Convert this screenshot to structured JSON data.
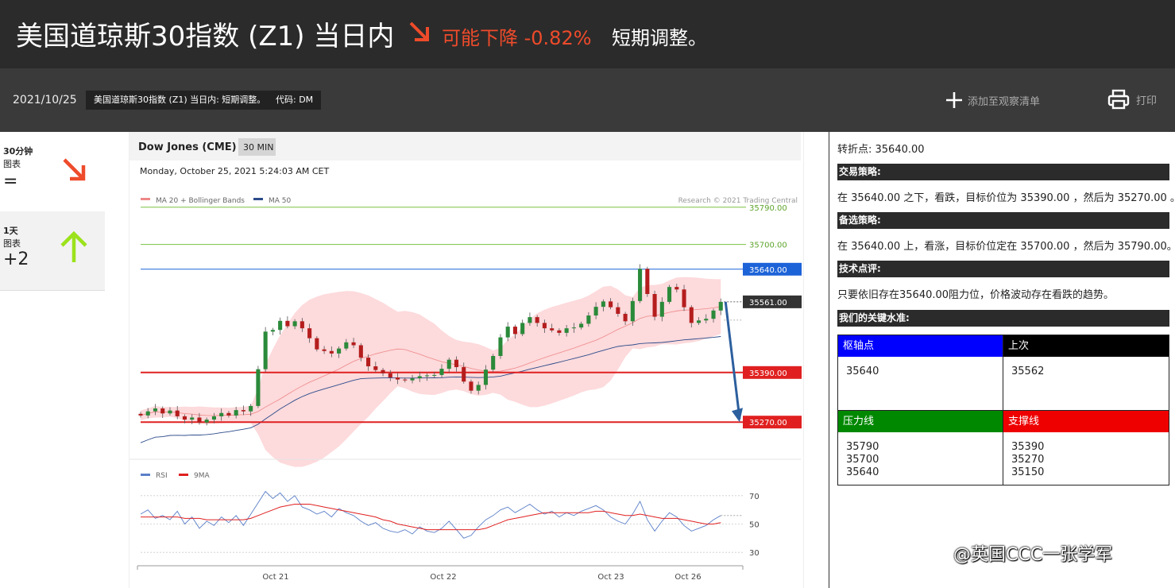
{
  "header": {
    "title": "美国道琼斯30指数 (Z1) 当日内",
    "trend_icon": "arrow-down-right-icon",
    "change_text": "可能下降 -0.82%",
    "summary": "短期调整。",
    "accent_color": "#ee4b2b"
  },
  "subbar": {
    "date": "2021/10/25",
    "name_chip": "美国道琼斯30指数 (Z1) 当日内: 短期调整。",
    "code_chip": "代码: DM",
    "watchlist_label": "添加至观察清单",
    "print_label": "打印"
  },
  "timeframes": [
    {
      "label": "30分钟",
      "sub": "图表",
      "score": "=",
      "icon": "arrow-down-right-icon",
      "color": "#ee4b2b"
    },
    {
      "label": "1天",
      "sub": "图表",
      "score": "+2",
      "icon": "arrow-up-icon",
      "color": "#9be21b"
    }
  ],
  "chart_header": {
    "instrument": "Dow Jones (CME)",
    "interval": "30 MIN",
    "timestamp": "Monday, October 25, 2021 5:24:03 AM CET",
    "legend_ma20": "MA 20 + Bollinger Bands",
    "legend_ma50": "MA 50",
    "credit": "Research © 2021 Trading Central"
  },
  "chart_data": [
    {
      "type": "candlestick",
      "x_tick_labels": [
        "Oct 21",
        "Oct 22",
        "Oct 23",
        "Oct 26"
      ],
      "levels": [
        {
          "value": 35790.0,
          "label": "35790.00",
          "kind": "resistance",
          "color": "#7ac142"
        },
        {
          "value": 35700.0,
          "label": "35700.00",
          "kind": "resistance",
          "color": "#7ac142"
        },
        {
          "value": 35640.0,
          "label": "35640.00",
          "kind": "pivot",
          "color": "#1d63d8"
        },
        {
          "value": 35561.0,
          "label": "35561.00",
          "kind": "last",
          "color": "#333333"
        },
        {
          "value": 35390.0,
          "label": "35390.00",
          "kind": "support",
          "color": "#e02020"
        },
        {
          "value": 35270.0,
          "label": "35270.00",
          "kind": "support",
          "color": "#e02020"
        }
      ],
      "forecast": {
        "from": 35561,
        "to": 35270
      },
      "close_series": [
        35286,
        35296,
        35303,
        35291,
        35298,
        35284,
        35276,
        35281,
        35269,
        35276,
        35284,
        35292,
        35286,
        35299,
        35296,
        35309,
        35398,
        35489,
        35493,
        35515,
        35502,
        35514,
        35497,
        35473,
        35446,
        35442,
        35436,
        35448,
        35463,
        35456,
        35426,
        35405,
        35396,
        35388,
        35378,
        35373,
        35371,
        35376,
        35381,
        35383,
        35384,
        35399,
        35421,
        35403,
        35368,
        35346,
        35360,
        35397,
        35430,
        35475,
        35501,
        35483,
        35510,
        35524,
        35510,
        35497,
        35492,
        35486,
        35497,
        35499,
        35508,
        35528,
        35549,
        35562,
        35548,
        35532,
        35514,
        35563,
        35641,
        35580,
        35525,
        35561,
        35597,
        35591,
        35548,
        35510,
        35516,
        35520,
        35540,
        35561
      ],
      "y_range": [
        35180,
        35830
      ]
    },
    {
      "type": "line",
      "series": [
        {
          "name": "RSI",
          "color": "#5b7fc8"
        },
        {
          "name": "9MA",
          "color": "#e02020"
        }
      ],
      "y_ticks": [
        70,
        50,
        30
      ],
      "y_range": [
        20,
        80
      ],
      "rsi": [
        57,
        60,
        54,
        56,
        53,
        59,
        50,
        55,
        47,
        52,
        49,
        55,
        51,
        56,
        49,
        57,
        65,
        73,
        68,
        72,
        66,
        70,
        62,
        60,
        57,
        59,
        55,
        61,
        58,
        56,
        52,
        49,
        51,
        47,
        45,
        44,
        46,
        43,
        48,
        45,
        44,
        47,
        52,
        46,
        40,
        42,
        48,
        53,
        56,
        60,
        62,
        58,
        61,
        64,
        60,
        57,
        59,
        55,
        58,
        56,
        59,
        61,
        63,
        60,
        55,
        52,
        50,
        57,
        66,
        53,
        45,
        52,
        58,
        55,
        49,
        45,
        47,
        49,
        53,
        56
      ],
      "ma9": [
        55,
        55,
        55,
        55,
        55,
        55,
        54,
        54,
        54,
        53,
        53,
        53,
        53,
        53,
        53,
        54,
        56,
        58,
        60,
        62,
        63,
        64,
        64,
        64,
        63,
        62,
        61,
        60,
        59,
        58,
        57,
        56,
        55,
        53,
        52,
        50,
        49,
        48,
        47,
        46,
        46,
        46,
        46,
        46,
        46,
        46,
        46,
        47,
        49,
        51,
        53,
        54,
        55,
        56,
        57,
        58,
        58,
        58,
        58,
        58,
        58,
        58,
        59,
        59,
        58,
        57,
        56,
        56,
        57,
        56,
        55,
        54,
        54,
        54,
        53,
        52,
        51,
        50,
        50,
        51
      ]
    }
  ],
  "analysis": {
    "pivot_line": "转折点: 35640.00",
    "sections": [
      {
        "title": "交易策略:",
        "text": "在 35640.00 之下，看跌，目标价位为 35390.00 ，然后为 35270.00 。"
      },
      {
        "title": "备选策略:",
        "text": "在 35640.00 上，看涨，目标价位定在 35700.00 ，然后为 35790.00。"
      },
      {
        "title": "技术点评:",
        "text": "只要依旧存在35640.00阻力位，价格波动存在看跌的趋势。"
      }
    ],
    "levels_title": "我们的关键水准:",
    "levels_table": {
      "pivot_header": "枢轴点",
      "pivot_values": "35640",
      "last_header": "上次",
      "last_values": "35562",
      "resistance_header": "压力线",
      "resistance_values": "35790\n35700\n35640",
      "support_header": "支撑线",
      "support_values": "35390\n35270\n35150",
      "colors": {
        "pivot": "#0000ff",
        "last": "#000000",
        "resistance": "#008800",
        "support": "#ee0000"
      }
    }
  },
  "watermark": "@英国CCC一张学军"
}
